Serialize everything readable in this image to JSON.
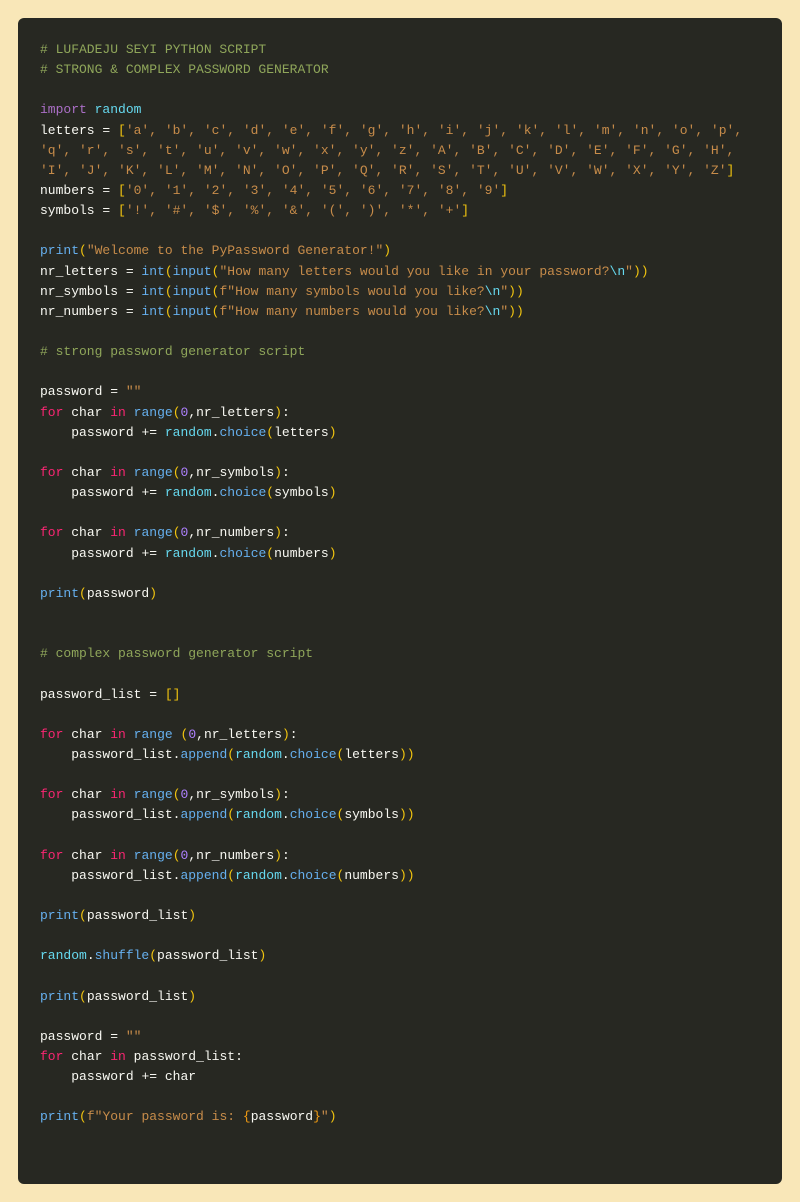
{
  "comments": {
    "header1": "# LUFADEJU SEYI PYTHON SCRIPT",
    "header2": "# STRONG & COMPLEX PASSWORD GENERATOR",
    "strong": "# strong password generator script",
    "complex": "# complex password generator script"
  },
  "kw": {
    "import": "import",
    "for": "for",
    "in": "in"
  },
  "mod": {
    "random": "random"
  },
  "vars": {
    "letters": "letters",
    "numbers": "numbers",
    "symbols": "symbols",
    "password": "password",
    "password_list": "password_list",
    "nr_letters": "nr_letters",
    "nr_symbols": "nr_symbols",
    "nr_numbers": "nr_numbers",
    "char": "char"
  },
  "fn": {
    "print": "print",
    "int": "int",
    "input": "input",
    "range": "range",
    "choice": "choice",
    "append": "append",
    "shuffle": "shuffle"
  },
  "strings": {
    "letters_list": "'a', 'b', 'c', 'd', 'e', 'f', 'g', 'h', 'i', 'j', 'k', 'l', 'm', 'n', 'o', 'p', 'q', 'r', 's', 't', 'u', 'v', 'w', 'x', 'y', 'z', 'A', 'B', 'C', 'D', 'E', 'F', 'G', 'H', 'I', 'J', 'K', 'L', 'M', 'N', 'O', 'P', 'Q', 'R', 'S', 'T', 'U', 'V', 'W', 'X', 'Y', 'Z'",
    "numbers_list": "'0', '1', '2', '3', '4', '5', '6', '7', '8', '9'",
    "symbols_list": "'!', '#', '$', '%', '&', '(', ')', '*', '+'",
    "welcome": "\"Welcome to the PyPassword Generator!\"",
    "prompt_letters_a": "\"How many letters would you like in your password?",
    "prompt_symbols_a": "\"How many symbols would you like?",
    "prompt_numbers_a": "\"How many numbers would you like?",
    "esc_n": "\\n",
    "close_q": "\"",
    "empty": "\"\"",
    "f_prefix": "f",
    "final_a": "\"Your password is: ",
    "final_b": "\""
  },
  "nums": {
    "zero": "0"
  },
  "punc": {
    "eq": " = ",
    "lbr": "[",
    "rbr": "]",
    "lpar": "(",
    "rpar": ")",
    "lcur": "{",
    "rcur": "}",
    "colon": ":",
    "comma": ",",
    "dot": ".",
    "pluseq": " += ",
    "indent": "    "
  }
}
